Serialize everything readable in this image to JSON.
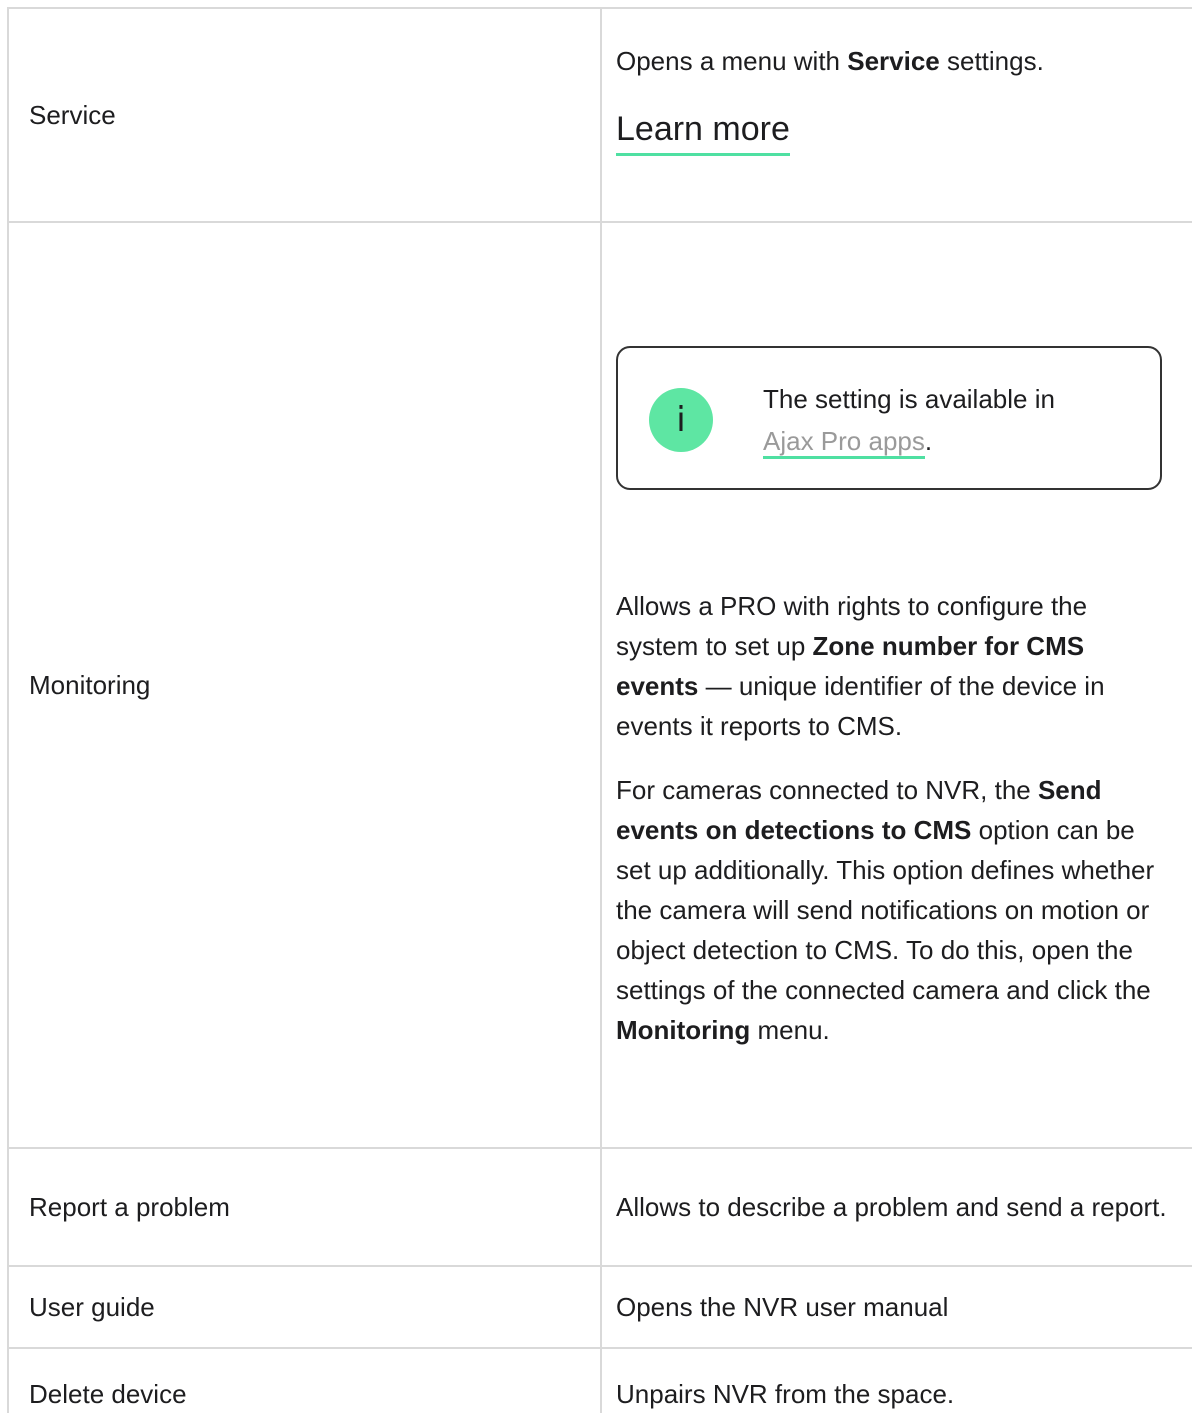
{
  "rows": [
    {
      "name": "Service",
      "desc_prefix": "Opens a menu with ",
      "desc_bold": "Service",
      "desc_suffix": " settings.",
      "link": "Learn more"
    },
    {
      "name": "Monitoring",
      "note": {
        "icon": "info-icon",
        "icon_glyph": "i",
        "text": "The setting is available in ",
        "link": "Ajax Pro apps",
        "after_link": "."
      },
      "p1_a": "Allows a PRO with rights to configure the system to set up ",
      "p1_bold": "Zone number for CMS events",
      "p1_b": " — unique identifier of the device in events it reports to CMS.",
      "p2_a": "For cameras connected to NVR, the ",
      "p2_bold1": "Send events on detections to CMS",
      "p2_b": " option can be set up additionally. This option defines whether the camera will send notifications on motion or object detection to CMS. To do this, open the settings of the connected camera and click the ",
      "p2_bold2": "Monitoring",
      "p2_c": " menu."
    },
    {
      "name": "Report a problem",
      "desc": "Allows to describe a problem and send a report."
    },
    {
      "name": "User guide",
      "desc": "Opens the NVR user manual"
    },
    {
      "name": "Delete device",
      "desc": "Unpairs NVR from the space."
    }
  ],
  "colors": {
    "accent": "#4fe0a2",
    "icon_bg": "#5ee6a3",
    "border": "#d9d9d9",
    "link_muted": "#9a9a9a"
  }
}
